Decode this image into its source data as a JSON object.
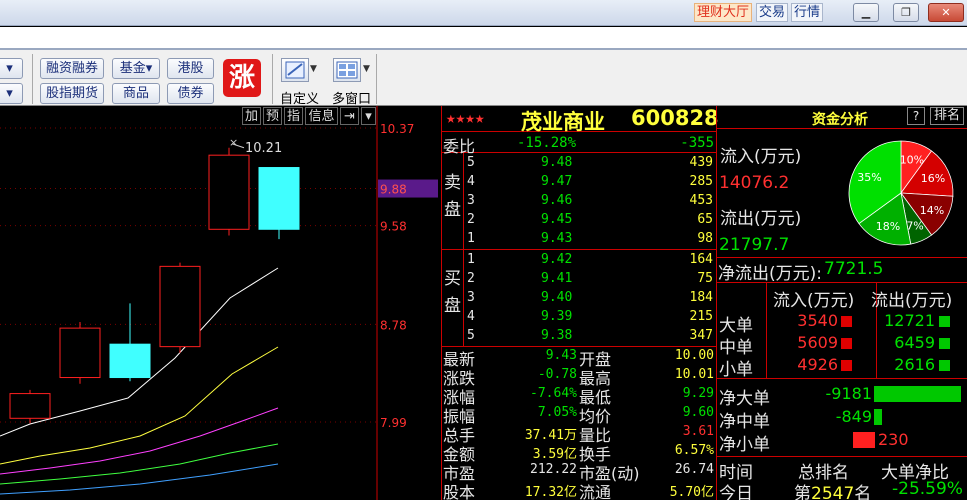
{
  "titlebar": {
    "links": [
      "理财大厅",
      "交易",
      "行情"
    ],
    "win_min": "▁",
    "win_restore": "❐",
    "win_close": "✕"
  },
  "toolbar": {
    "row1": [
      "融资融券",
      "基金",
      "港股"
    ],
    "row2": [
      "股指期货",
      "商品",
      "债券"
    ],
    "zhang_icon_text": "涨",
    "custom_label": "自定义",
    "multiwin_label": "多窗口",
    "left_stub_top": "▾",
    "left_stub_bottom": "▾"
  },
  "chart": {
    "mini_buttons": [
      "加",
      "预",
      "指",
      "信息",
      "⇥",
      "▾"
    ],
    "price_ticks": [
      "10.37",
      "9.88",
      "9.58",
      "8.78",
      "7.99"
    ],
    "current_price_tag": "9.88",
    "high_annotation": "10.21",
    "candles": [
      {
        "open": 8.02,
        "close": 8.22,
        "high": 8.25,
        "low": 7.98,
        "up": true
      },
      {
        "open": 8.35,
        "close": 8.75,
        "high": 8.8,
        "low": 8.3,
        "up": true
      },
      {
        "open": 8.62,
        "close": 8.35,
        "high": 8.95,
        "low": 8.32,
        "up": false
      },
      {
        "open": 8.6,
        "close": 9.25,
        "high": 9.28,
        "low": 8.55,
        "up": true
      },
      {
        "open": 9.55,
        "close": 10.15,
        "high": 10.21,
        "low": 9.5,
        "up": true
      },
      {
        "open": 10.05,
        "close": 9.55,
        "high": 10.05,
        "low": 9.47,
        "up": false
      }
    ]
  },
  "quote": {
    "stars": "★★★★",
    "name": "茂业商业",
    "code": "600828",
    "weibi_label": "委比",
    "weibi_pct": "-15.28%",
    "weibi_diff": "-355",
    "sell_label": "卖\n盘",
    "buy_label": "买\n盘",
    "sell": [
      {
        "lvl": "5",
        "price": "9.48",
        "vol": "439"
      },
      {
        "lvl": "4",
        "price": "9.47",
        "vol": "285"
      },
      {
        "lvl": "3",
        "price": "9.46",
        "vol": "453"
      },
      {
        "lvl": "2",
        "price": "9.45",
        "vol": "65"
      },
      {
        "lvl": "1",
        "price": "9.43",
        "vol": "98"
      }
    ],
    "buy": [
      {
        "lvl": "1",
        "price": "9.42",
        "vol": "164"
      },
      {
        "lvl": "2",
        "price": "9.41",
        "vol": "75"
      },
      {
        "lvl": "3",
        "price": "9.40",
        "vol": "184"
      },
      {
        "lvl": "4",
        "price": "9.39",
        "vol": "215"
      },
      {
        "lvl": "5",
        "price": "9.38",
        "vol": "347"
      }
    ],
    "stats": [
      {
        "l1": "最新",
        "v1": "9.43",
        "c1": "g",
        "l2": "开盘",
        "v2": "10.00",
        "c2": "y"
      },
      {
        "l1": "涨跌",
        "v1": "-0.78",
        "c1": "g",
        "l2": "最高",
        "v2": "10.01",
        "c2": "y"
      },
      {
        "l1": "涨幅",
        "v1": "-7.64%",
        "c1": "g",
        "l2": "最低",
        "v2": "9.29",
        "c2": "g"
      },
      {
        "l1": "振幅",
        "v1": "7.05%",
        "c1": "g",
        "l2": "均价",
        "v2": "9.60",
        "c2": "g"
      },
      {
        "l1": "总手",
        "v1": "37.41万",
        "c1": "y",
        "l2": "量比",
        "v2": "3.61",
        "c2": "r"
      },
      {
        "l1": "金额",
        "v1": "3.59亿",
        "c1": "y",
        "l2": "换手",
        "v2": "6.57%",
        "c2": "y"
      },
      {
        "l1": "市盈",
        "v1": "212.22",
        "c1": "w",
        "l2": "市盈(动)",
        "v2": "26.74",
        "c2": "w"
      },
      {
        "l1": "股本",
        "v1": "17.32亿",
        "c1": "y",
        "l2": "流通",
        "v2": "5.70亿",
        "c2": "y"
      }
    ]
  },
  "fund": {
    "title": "资金分析",
    "help": "?",
    "rank": "排名",
    "inflow_label": "流入(万元)",
    "inflow_value": "14076.2",
    "outflow_label": "流出(万元)",
    "outflow_value": "21797.7",
    "net_label": "净流出(万元):",
    "net_value": "7721.5",
    "pie": [
      {
        "label": "10%",
        "value": 10,
        "color": "#ff2020"
      },
      {
        "label": "16%",
        "value": 16,
        "color": "#d40000"
      },
      {
        "label": "14%",
        "value": 14,
        "color": "#8a0000"
      },
      {
        "label": "7%",
        "value": 7,
        "color": "#006400"
      },
      {
        "label": "18%",
        "value": 18,
        "color": "#00b000"
      },
      {
        "label": "35%",
        "value": 35,
        "color": "#00e000"
      }
    ],
    "col_in": "流入(万元)",
    "col_out": "流出(万元)",
    "rows": [
      {
        "label": "大单",
        "in": "3540",
        "out": "12721"
      },
      {
        "label": "中单",
        "in": "5609",
        "out": "6459"
      },
      {
        "label": "小单",
        "in": "4926",
        "out": "2616"
      }
    ],
    "net_rows": [
      {
        "label": "净大单",
        "value": "-9181",
        "fill": 1.0,
        "color": "#00c800"
      },
      {
        "label": "净中单",
        "value": "-849",
        "fill": 0.09,
        "color": "#00c800"
      },
      {
        "label": "净小单",
        "value": "230",
        "fill": 0.025,
        "color": "#ff2020"
      }
    ],
    "bottom_headers": [
      "时间",
      "总排名",
      "大单净比"
    ],
    "bottom_row": {
      "label": "今日",
      "rank_prefix": "第",
      "rank": "2547",
      "rank_suffix": "名",
      "ratio": "-25.59%"
    }
  }
}
